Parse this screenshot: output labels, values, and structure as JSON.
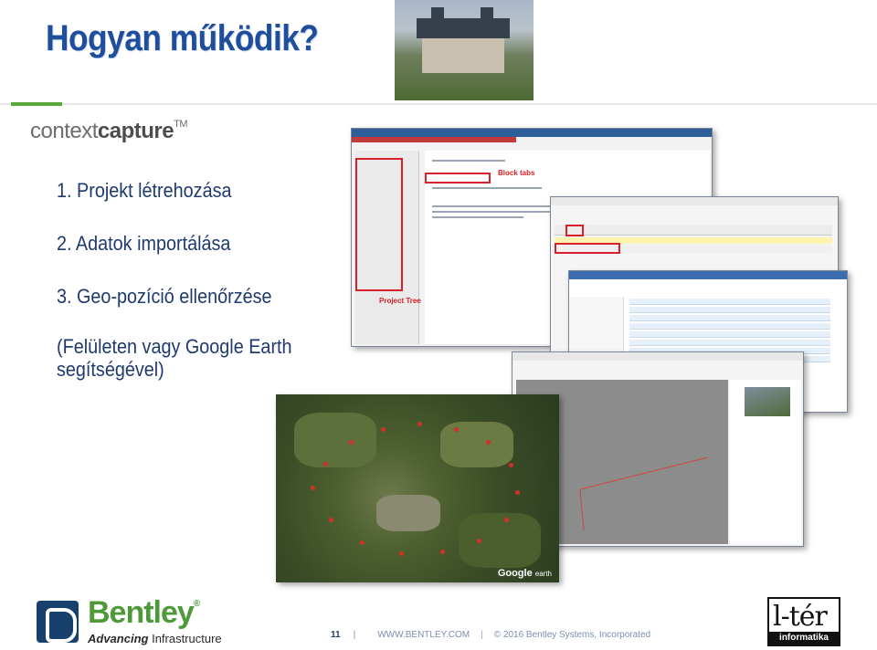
{
  "slide": {
    "title": "Hogyan működik?",
    "product_logo": {
      "light": "context",
      "bold": "capture",
      "tm": "TM"
    },
    "steps": [
      "1. Projekt létrehozása",
      "2. Adatok importálása",
      "3. Geo-pozíció ellenőrzése"
    ],
    "note": "(Felületen vagy Google Earth segítségével)"
  },
  "screenshots": {
    "main_window": {
      "block_tabs_label": "Block tabs",
      "project_tree_label": "Project Tree"
    },
    "earth": {
      "logo_google": "Google",
      "logo_earth": "earth"
    }
  },
  "footer": {
    "page_number": "11",
    "site": "WWW.BENTLEY.COM",
    "copyright": "© 2016 Bentley Systems, Incorporated"
  },
  "logos": {
    "bentley_name": "Bentley",
    "bentley_reg": "®",
    "bentley_tag_bold": "Advancing",
    "bentley_tag_rest": " Infrastructure",
    "lter_main": "l-tér",
    "lter_sub": "informatika"
  },
  "colors": {
    "title": "#1f4e9c",
    "accent_green": "#5aa83c",
    "highlight_red": "#d8202a",
    "bentley_green": "#4e9a3a"
  }
}
